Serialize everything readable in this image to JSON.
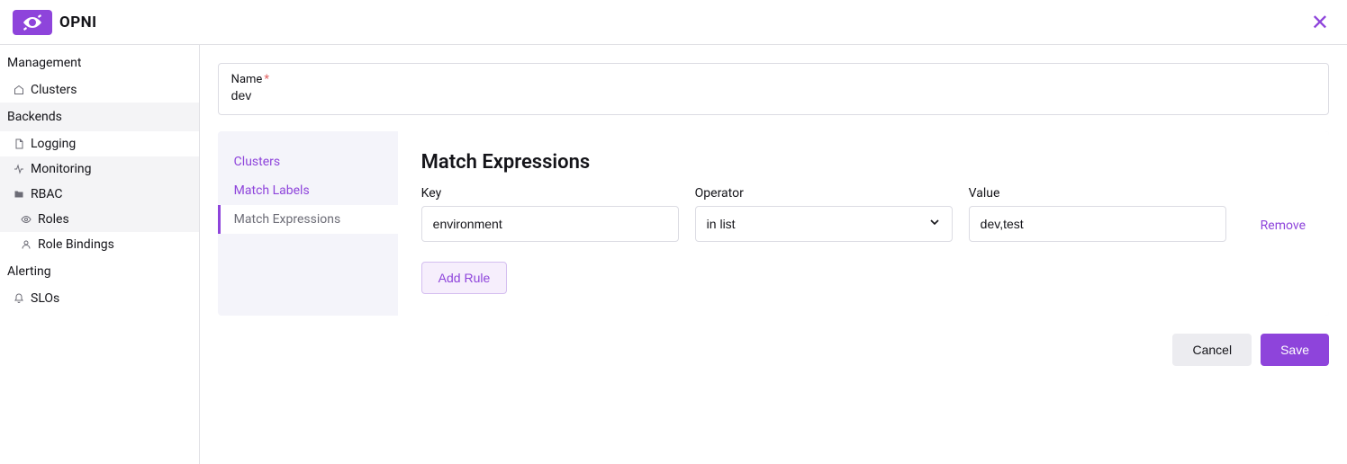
{
  "brand": {
    "name": "OPNI"
  },
  "sidebar": {
    "sections": [
      {
        "header": "Management",
        "items": [
          {
            "label": "Clusters"
          }
        ]
      },
      {
        "header": "Backends",
        "items": [
          {
            "label": "Logging"
          },
          {
            "label": "Monitoring"
          },
          {
            "label": "RBAC"
          },
          {
            "label": "Roles"
          },
          {
            "label": "Role Bindings"
          }
        ]
      },
      {
        "header": "Alerting",
        "items": [
          {
            "label": "SLOs"
          }
        ]
      }
    ]
  },
  "form": {
    "name_label": "Name",
    "name_value": "dev"
  },
  "tabs": {
    "clusters": "Clusters",
    "match_labels": "Match Labels",
    "match_expressions": "Match Expressions"
  },
  "expressions": {
    "title": "Match Expressions",
    "key_label": "Key",
    "operator_label": "Operator",
    "value_label": "Value",
    "rows": [
      {
        "key": "environment",
        "operator": "in list",
        "value": "dev,test"
      }
    ],
    "remove": "Remove",
    "add_rule": "Add Rule"
  },
  "actions": {
    "cancel": "Cancel",
    "save": "Save"
  }
}
